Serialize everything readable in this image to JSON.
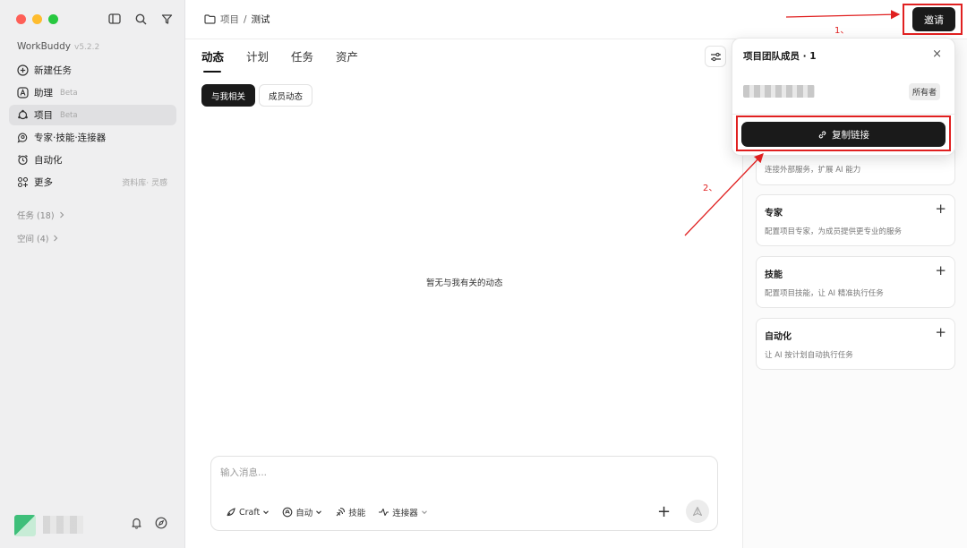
{
  "app": {
    "name": "WorkBuddy",
    "version": "v5.2.2"
  },
  "colors": {
    "accent": "#1a1a1a",
    "annotation": "#e02020",
    "sidebar_bg": "#efeff0"
  },
  "sidebar": {
    "nav": [
      {
        "label": "新建任务",
        "icon": "plus-circle-icon"
      },
      {
        "label": "助理",
        "tag": "Beta",
        "icon": "assistant-icon"
      },
      {
        "label": "项目",
        "tag": "Beta",
        "icon": "project-icon",
        "active": true
      },
      {
        "label": "专家·技能·连接器",
        "icon": "expert-icon"
      },
      {
        "label": "自动化",
        "icon": "alarm-icon"
      },
      {
        "label": "更多",
        "right": "资料库· 灵感",
        "icon": "grid-icon"
      }
    ],
    "groups": [
      {
        "label": "任务 (18)"
      },
      {
        "label": "空间 (4)"
      }
    ]
  },
  "breadcrumb": {
    "parent": "项目",
    "sep": "/",
    "current": "测试"
  },
  "header": {
    "invite_label": "邀请"
  },
  "annotations": {
    "step1": "1、",
    "step2": "2、"
  },
  "tabs": [
    {
      "label": "动态",
      "active": true
    },
    {
      "label": "计划"
    },
    {
      "label": "任务"
    },
    {
      "label": "资产"
    }
  ],
  "filters": [
    {
      "label": "与我相关",
      "active": true
    },
    {
      "label": "成员动态"
    }
  ],
  "empty_text": "暂无与我有关的动态",
  "composer": {
    "placeholder": "输入消息...",
    "tools": [
      {
        "label": "Craft",
        "icon": "craft-icon",
        "dropdown": true
      },
      {
        "label": "自动",
        "icon": "auto-icon",
        "dropdown": true
      },
      {
        "label": "技能",
        "icon": "skill-icon"
      },
      {
        "label": "连接器",
        "icon": "connector-icon",
        "dropdown": true
      }
    ]
  },
  "popover": {
    "title": "项目团队成员 · 1",
    "owner_label": "所有者",
    "copy_link_label": "复制链接"
  },
  "cards": [
    {
      "desc": "连接外部服务，扩展 AI 能力"
    },
    {
      "title": "专家",
      "desc": "配置项目专家，为成员提供更专业的服务"
    },
    {
      "title": "技能",
      "desc": "配置项目技能，让 AI 精准执行任务"
    },
    {
      "title": "自动化",
      "desc": "让 AI 按计划自动执行任务"
    }
  ]
}
